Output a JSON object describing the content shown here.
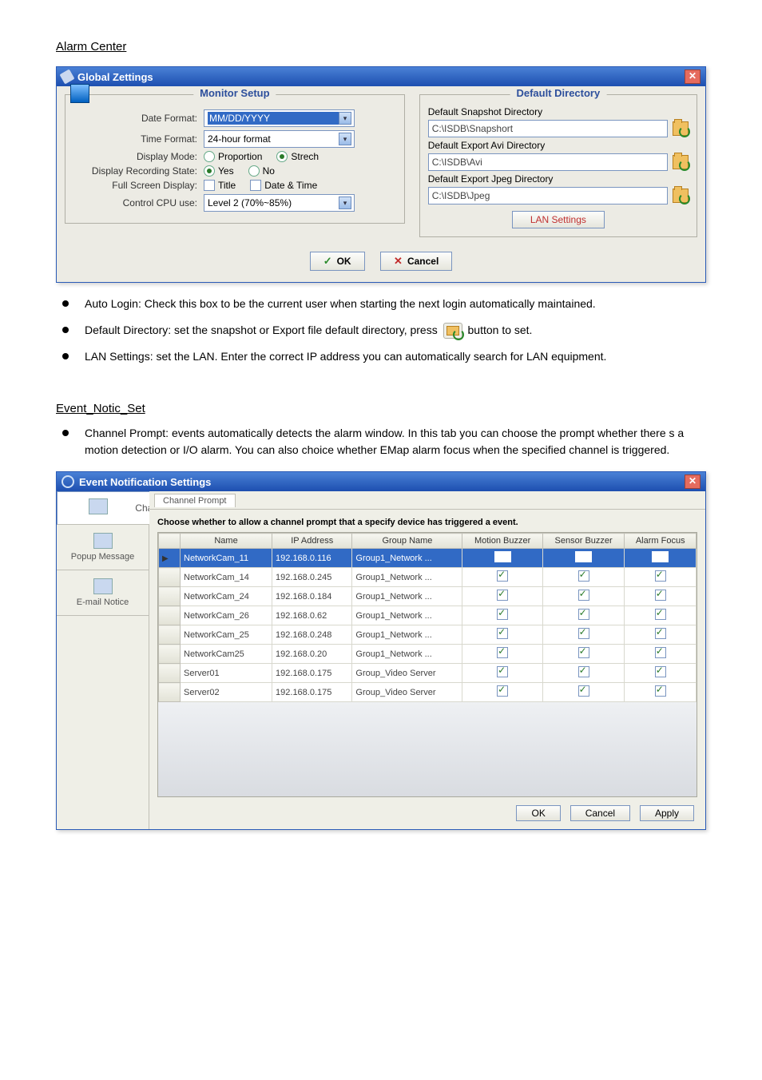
{
  "sections": {
    "alarm_center_heading": "Alarm Center",
    "event_settings_heading": "Event_Notic_Set"
  },
  "globals": {
    "title": "Global Zettings",
    "monitor": {
      "legend": "Monitor Setup",
      "date_format_label": "Date Format:",
      "date_format_value": "MM/DD/YYYY",
      "time_format_label": "Time Format:",
      "time_format_value": "24-hour format",
      "display_mode_label": "Display Mode:",
      "display_mode_opt1": "Proportion",
      "display_mode_opt2": "Strech",
      "recording_state_label": "Display Recording State:",
      "recording_state_opt1": "Yes",
      "recording_state_opt2": "No",
      "fullscreen_label": "Full Screen Display:",
      "fullscreen_opt1": "Title",
      "fullscreen_opt2": "Date & Time",
      "cpu_label": "Control CPU use:",
      "cpu_value": "Level 2 (70%~85%)"
    },
    "dirs": {
      "legend": "Default Directory",
      "snap_label": "Default Snapshot Directory",
      "snap_value": "C:\\ISDB\\Snapshort",
      "avi_label": "Default Export Avi Directory",
      "avi_value": "C:\\ISDB\\Avi",
      "jpeg_label": "Default Export Jpeg Directory",
      "jpeg_value": "C:\\ISDB\\Jpeg"
    },
    "lan_button": "LAN Settings",
    "ok": "OK",
    "cancel": "Cancel"
  },
  "bullets": {
    "b1": "Auto Login: Check this box to be the current user when starting the next login automatically maintained.",
    "b2_pre": "Default Directory: set the snapshot or Export file default directory, press ",
    "b2_post": " button to set.",
    "b3": "LAN Settings: set the LAN. Enter the correct IP address you can automatically search for LAN equipment.",
    "channel_prompt": "Channel Prompt: events automatically detects the alarm window. In this tab you can choose the prompt whether there s a motion detection or I/O alarm. You can also choice whether EMap alarm focus when the specified channel is triggered."
  },
  "ens": {
    "title": "Event Notification Settings",
    "side": {
      "channel_prompt": "Channel Prompt",
      "popup_message": "Popup Message",
      "email_notice": "E-mail Notice"
    },
    "tab": "Channel Prompt",
    "help": "Choose whether to allow a channel prompt that a specify device has triggered a event.",
    "cols": {
      "name": "Name",
      "ip": "IP Address",
      "group": "Group Name",
      "motion": "Motion Buzzer",
      "sensor": "Sensor Buzzer",
      "alarm": "Alarm Focus"
    },
    "rows": [
      {
        "name": "NetworkCam_11",
        "ip": "192.168.0.116",
        "group": "Group1_Network ..."
      },
      {
        "name": "NetworkCam_14",
        "ip": "192.168.0.245",
        "group": "Group1_Network ..."
      },
      {
        "name": "NetworkCam_24",
        "ip": "192.168.0.184",
        "group": "Group1_Network ..."
      },
      {
        "name": "NetworkCam_26",
        "ip": "192.168.0.62",
        "group": "Group1_Network ..."
      },
      {
        "name": "NetworkCam_25",
        "ip": "192.168.0.248",
        "group": "Group1_Network ..."
      },
      {
        "name": "NetworkCam25",
        "ip": "192.168.0.20",
        "group": "Group1_Network ..."
      },
      {
        "name": "Server01",
        "ip": "192.168.0.175",
        "group": "Group_Video Server"
      },
      {
        "name": "Server02",
        "ip": "192.168.0.175",
        "group": "Group_Video Server"
      }
    ],
    "ok": "OK",
    "cancel": "Cancel",
    "apply": "Apply"
  }
}
